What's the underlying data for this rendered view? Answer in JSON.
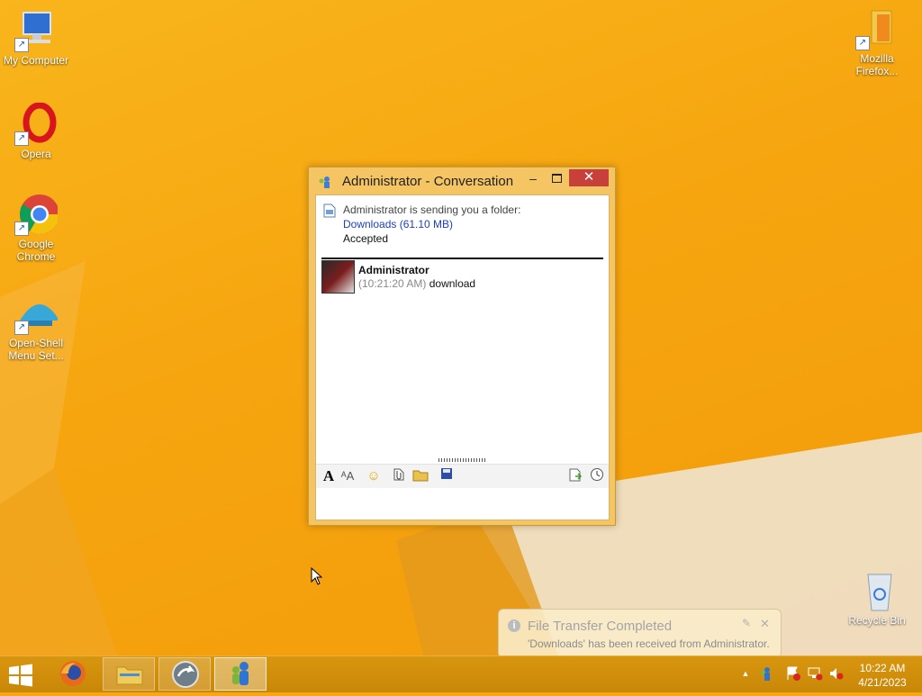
{
  "desktop": {
    "icons": [
      {
        "label": "My Computer"
      },
      {
        "label": "Opera"
      },
      {
        "label": "Google Chrome"
      },
      {
        "label": "Open-Shell Menu Set..."
      },
      {
        "label": "Mozilla Firefox..."
      },
      {
        "label": "Recycle Bin"
      }
    ]
  },
  "conversation": {
    "title": "Administrator - Conversation",
    "close_glyph": "✕",
    "minimize_glyph": "–",
    "notice_text": "Administrator is sending you a folder:",
    "notice_link": "Downloads (61.10 MB)",
    "notice_status": "Accepted",
    "message": {
      "sender": "Administrator",
      "time": "(10:21:20 AM)",
      "text": "download"
    },
    "input_value": ""
  },
  "notification": {
    "title": "File Transfer Completed",
    "body": "'Downloads' has been received from Administrator."
  },
  "taskbar": {
    "time": "10:22 AM",
    "date": "4/21/2023",
    "tray_overflow_glyph": "▲"
  },
  "colors": {
    "desktop": "#f6a712",
    "window_frame": "#f4c562",
    "close_button": "#c7413a",
    "link": "#1c3fc0"
  }
}
